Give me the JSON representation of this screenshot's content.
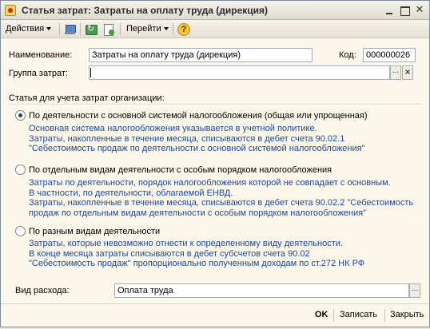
{
  "window": {
    "title": "Статья затрат: Затраты на оплату труда (дирекция)"
  },
  "toolbar": {
    "actions_label": "Действия",
    "goto_label": "Перейти",
    "help_label": "?"
  },
  "form": {
    "name_label": "Наименование:",
    "name_value": "Затраты на оплату труда (дирекция)",
    "code_label": "Код:",
    "code_value": "000000026",
    "group_label": "Группа затрат:",
    "group_value": "",
    "group_select_btn": "...",
    "group_clear_btn": "×",
    "section_title": "Статья для учета затрат организации:",
    "options": [
      {
        "label": "По деятельности с основной системой налогообложения (общая или упрощенная)",
        "checked": true,
        "description": [
          "Основная система налогообложения указывается в учетной политике.",
          "Затраты, накопленные в течение месяца, списываются в дебет счета 90.02.1",
          "\"Себестоимость продаж по деятельности с основной системой налогообложения\""
        ]
      },
      {
        "label": "По отдельным видам деятельности с особым порядком налогообложения",
        "checked": false,
        "description": [
          "Затраты по деятельности, порядок налогообложения которой не совпадает с основным.",
          "В частности, по деятельности, облагаемой ЕНВД.",
          "Затраты, накопленные в течение месяца, списываются в дебет счета 90.02.2 \"Себестоимость",
          "продаж по отдельным видам деятельности с особым порядком налогообложения\""
        ]
      },
      {
        "label": "По разным видам деятельности",
        "checked": false,
        "description": [
          "Затраты, которые невозможно отнести к определенному виду деятельности.",
          "В конце месяца затраты списываются в дебет субсчетов счета 90.02",
          "\"Себестоимость продаж\" пропорционально полученным доходам по ст.272 НК РФ"
        ]
      }
    ],
    "expense_label": "Вид расхода:",
    "expense_value": "Оплата труда",
    "expense_select_btn": "..."
  },
  "buttons": {
    "ok": "OK",
    "save": "Записать",
    "close": "Закрыть"
  }
}
